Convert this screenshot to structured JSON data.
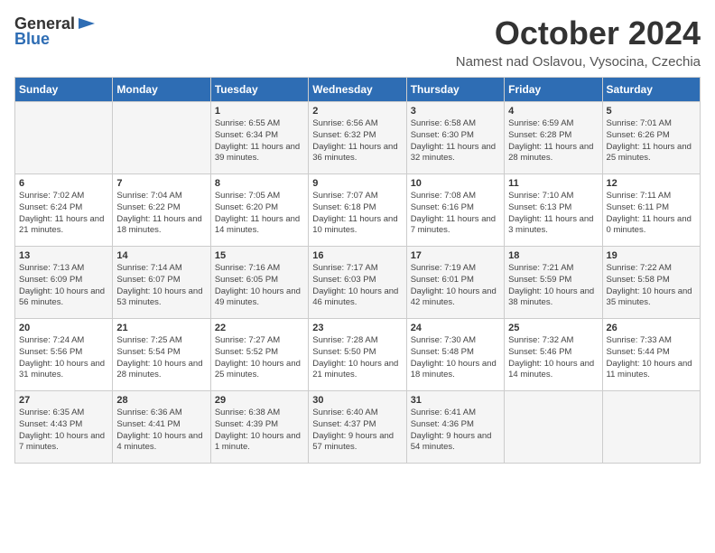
{
  "logo": {
    "general": "General",
    "blue": "Blue"
  },
  "title": "October 2024",
  "subtitle": "Namest nad Oslavou, Vysocina, Czechia",
  "headers": [
    "Sunday",
    "Monday",
    "Tuesday",
    "Wednesday",
    "Thursday",
    "Friday",
    "Saturday"
  ],
  "weeks": [
    [
      {
        "day": "",
        "sunrise": "",
        "sunset": "",
        "daylight": ""
      },
      {
        "day": "",
        "sunrise": "",
        "sunset": "",
        "daylight": ""
      },
      {
        "day": "1",
        "sunrise": "Sunrise: 6:55 AM",
        "sunset": "Sunset: 6:34 PM",
        "daylight": "Daylight: 11 hours and 39 minutes."
      },
      {
        "day": "2",
        "sunrise": "Sunrise: 6:56 AM",
        "sunset": "Sunset: 6:32 PM",
        "daylight": "Daylight: 11 hours and 36 minutes."
      },
      {
        "day": "3",
        "sunrise": "Sunrise: 6:58 AM",
        "sunset": "Sunset: 6:30 PM",
        "daylight": "Daylight: 11 hours and 32 minutes."
      },
      {
        "day": "4",
        "sunrise": "Sunrise: 6:59 AM",
        "sunset": "Sunset: 6:28 PM",
        "daylight": "Daylight: 11 hours and 28 minutes."
      },
      {
        "day": "5",
        "sunrise": "Sunrise: 7:01 AM",
        "sunset": "Sunset: 6:26 PM",
        "daylight": "Daylight: 11 hours and 25 minutes."
      }
    ],
    [
      {
        "day": "6",
        "sunrise": "Sunrise: 7:02 AM",
        "sunset": "Sunset: 6:24 PM",
        "daylight": "Daylight: 11 hours and 21 minutes."
      },
      {
        "day": "7",
        "sunrise": "Sunrise: 7:04 AM",
        "sunset": "Sunset: 6:22 PM",
        "daylight": "Daylight: 11 hours and 18 minutes."
      },
      {
        "day": "8",
        "sunrise": "Sunrise: 7:05 AM",
        "sunset": "Sunset: 6:20 PM",
        "daylight": "Daylight: 11 hours and 14 minutes."
      },
      {
        "day": "9",
        "sunrise": "Sunrise: 7:07 AM",
        "sunset": "Sunset: 6:18 PM",
        "daylight": "Daylight: 11 hours and 10 minutes."
      },
      {
        "day": "10",
        "sunrise": "Sunrise: 7:08 AM",
        "sunset": "Sunset: 6:16 PM",
        "daylight": "Daylight: 11 hours and 7 minutes."
      },
      {
        "day": "11",
        "sunrise": "Sunrise: 7:10 AM",
        "sunset": "Sunset: 6:13 PM",
        "daylight": "Daylight: 11 hours and 3 minutes."
      },
      {
        "day": "12",
        "sunrise": "Sunrise: 7:11 AM",
        "sunset": "Sunset: 6:11 PM",
        "daylight": "Daylight: 11 hours and 0 minutes."
      }
    ],
    [
      {
        "day": "13",
        "sunrise": "Sunrise: 7:13 AM",
        "sunset": "Sunset: 6:09 PM",
        "daylight": "Daylight: 10 hours and 56 minutes."
      },
      {
        "day": "14",
        "sunrise": "Sunrise: 7:14 AM",
        "sunset": "Sunset: 6:07 PM",
        "daylight": "Daylight: 10 hours and 53 minutes."
      },
      {
        "day": "15",
        "sunrise": "Sunrise: 7:16 AM",
        "sunset": "Sunset: 6:05 PM",
        "daylight": "Daylight: 10 hours and 49 minutes."
      },
      {
        "day": "16",
        "sunrise": "Sunrise: 7:17 AM",
        "sunset": "Sunset: 6:03 PM",
        "daylight": "Daylight: 10 hours and 46 minutes."
      },
      {
        "day": "17",
        "sunrise": "Sunrise: 7:19 AM",
        "sunset": "Sunset: 6:01 PM",
        "daylight": "Daylight: 10 hours and 42 minutes."
      },
      {
        "day": "18",
        "sunrise": "Sunrise: 7:21 AM",
        "sunset": "Sunset: 5:59 PM",
        "daylight": "Daylight: 10 hours and 38 minutes."
      },
      {
        "day": "19",
        "sunrise": "Sunrise: 7:22 AM",
        "sunset": "Sunset: 5:58 PM",
        "daylight": "Daylight: 10 hours and 35 minutes."
      }
    ],
    [
      {
        "day": "20",
        "sunrise": "Sunrise: 7:24 AM",
        "sunset": "Sunset: 5:56 PM",
        "daylight": "Daylight: 10 hours and 31 minutes."
      },
      {
        "day": "21",
        "sunrise": "Sunrise: 7:25 AM",
        "sunset": "Sunset: 5:54 PM",
        "daylight": "Daylight: 10 hours and 28 minutes."
      },
      {
        "day": "22",
        "sunrise": "Sunrise: 7:27 AM",
        "sunset": "Sunset: 5:52 PM",
        "daylight": "Daylight: 10 hours and 25 minutes."
      },
      {
        "day": "23",
        "sunrise": "Sunrise: 7:28 AM",
        "sunset": "Sunset: 5:50 PM",
        "daylight": "Daylight: 10 hours and 21 minutes."
      },
      {
        "day": "24",
        "sunrise": "Sunrise: 7:30 AM",
        "sunset": "Sunset: 5:48 PM",
        "daylight": "Daylight: 10 hours and 18 minutes."
      },
      {
        "day": "25",
        "sunrise": "Sunrise: 7:32 AM",
        "sunset": "Sunset: 5:46 PM",
        "daylight": "Daylight: 10 hours and 14 minutes."
      },
      {
        "day": "26",
        "sunrise": "Sunrise: 7:33 AM",
        "sunset": "Sunset: 5:44 PM",
        "daylight": "Daylight: 10 hours and 11 minutes."
      }
    ],
    [
      {
        "day": "27",
        "sunrise": "Sunrise: 6:35 AM",
        "sunset": "Sunset: 4:43 PM",
        "daylight": "Daylight: 10 hours and 7 minutes."
      },
      {
        "day": "28",
        "sunrise": "Sunrise: 6:36 AM",
        "sunset": "Sunset: 4:41 PM",
        "daylight": "Daylight: 10 hours and 4 minutes."
      },
      {
        "day": "29",
        "sunrise": "Sunrise: 6:38 AM",
        "sunset": "Sunset: 4:39 PM",
        "daylight": "Daylight: 10 hours and 1 minute."
      },
      {
        "day": "30",
        "sunrise": "Sunrise: 6:40 AM",
        "sunset": "Sunset: 4:37 PM",
        "daylight": "Daylight: 9 hours and 57 minutes."
      },
      {
        "day": "31",
        "sunrise": "Sunrise: 6:41 AM",
        "sunset": "Sunset: 4:36 PM",
        "daylight": "Daylight: 9 hours and 54 minutes."
      },
      {
        "day": "",
        "sunrise": "",
        "sunset": "",
        "daylight": ""
      },
      {
        "day": "",
        "sunrise": "",
        "sunset": "",
        "daylight": ""
      }
    ]
  ]
}
